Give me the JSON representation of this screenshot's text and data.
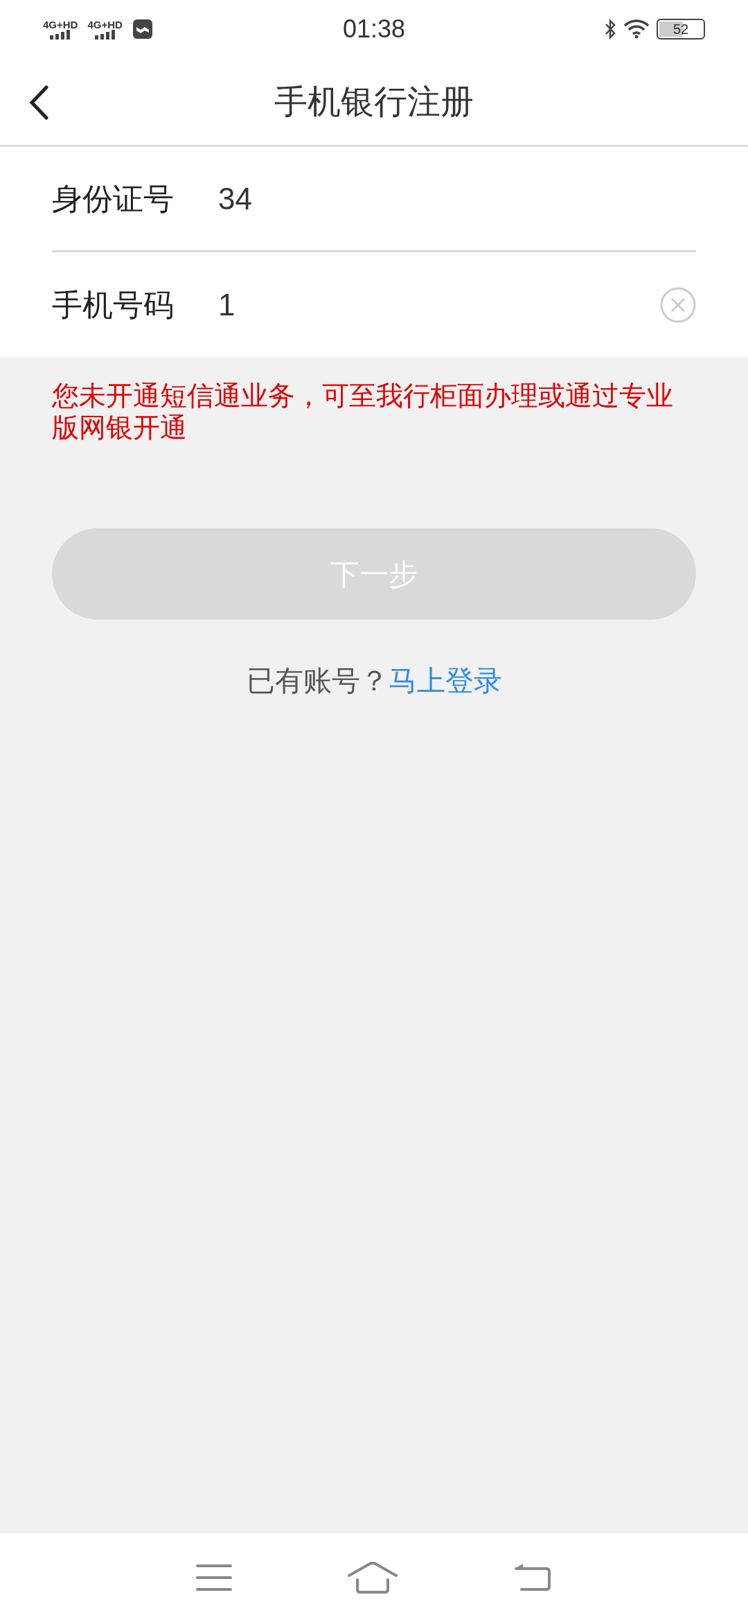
{
  "status_bar": {
    "signal_1": "4G+HD",
    "signal_2": "4G+HD",
    "time": "01:38",
    "battery": "52"
  },
  "header": {
    "title": "手机银行注册"
  },
  "form": {
    "fields": [
      {
        "label": "身份证号",
        "value": "34"
      },
      {
        "label": "手机号码",
        "value": "1",
        "clearable": true
      }
    ]
  },
  "error_message": "您未开通短信通业务，可至我行柜面办理或通过专业版网银开通",
  "next_button": {
    "label": "下一步",
    "disabled": true
  },
  "login_prompt": {
    "text": "已有账号？",
    "link": "马上登录"
  }
}
